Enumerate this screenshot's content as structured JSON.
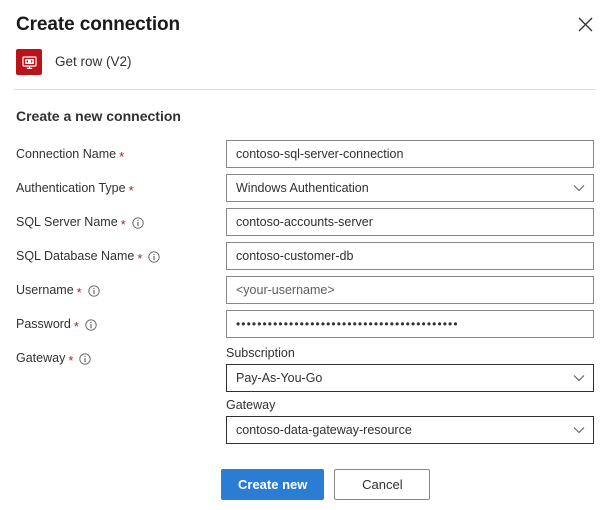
{
  "panel": {
    "title": "Create connection",
    "close_icon": "close-icon"
  },
  "connector": {
    "icon": "sql-server-monitor-icon",
    "icon_color": "#ba141a",
    "name": "Get row (V2)"
  },
  "section": {
    "heading": "Create a new connection"
  },
  "fields": [
    {
      "label": "Connection Name",
      "required_marker": "*",
      "has_info": false,
      "type": "text",
      "value": "contoso-sql-server-connection",
      "placeholder": "Connection Name"
    },
    {
      "label": "Authentication Type",
      "required_marker": "*",
      "has_info": false,
      "type": "select",
      "value": "Windows Authentication",
      "placeholder": "Authentication Type"
    },
    {
      "label": "SQL Server Name",
      "required_marker": "*",
      "has_info": true,
      "type": "text",
      "value": "contoso-accounts-server",
      "placeholder": "SQL Server Name"
    },
    {
      "label": "SQL Database Name",
      "required_marker": "*",
      "has_info": true,
      "type": "text",
      "value": "contoso-customer-db",
      "placeholder": "SQL Database Name"
    },
    {
      "label": "Username",
      "required_marker": "*",
      "has_info": true,
      "type": "text",
      "value": "<your-username>",
      "placeholder": "Username"
    },
    {
      "label": "Password",
      "required_marker": "*",
      "has_info": true,
      "type": "password",
      "value": "••••••••••••••••••••••••••••••••••••••••••",
      "placeholder": "Password"
    }
  ],
  "gateway": {
    "label": "Gateway",
    "required_marker": "*",
    "has_info": true,
    "subscription": {
      "label": "Subscription",
      "value": "Pay-As-You-Go",
      "placeholder": "Subscription"
    },
    "gateway_select": {
      "label": "Gateway",
      "value": "contoso-data-gateway-resource",
      "placeholder": "Gateway"
    }
  },
  "footer": {
    "primary_label": "Create new",
    "secondary_label": "Cancel",
    "primary_color": "#2b7cd3"
  }
}
